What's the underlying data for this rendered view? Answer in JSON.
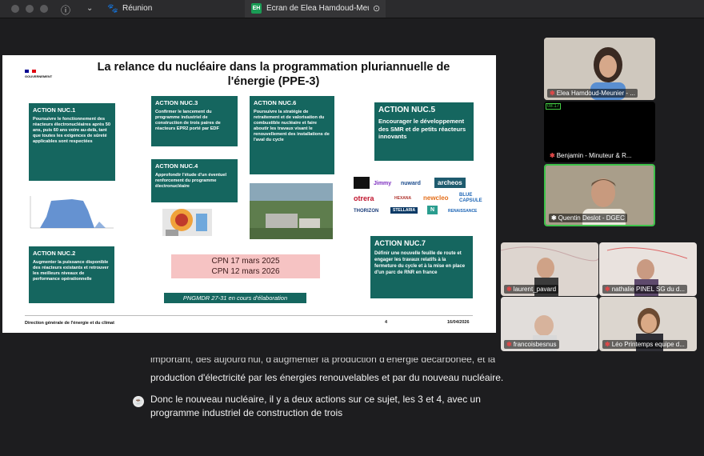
{
  "titlebar": {
    "meeting_title": "Réunion",
    "share_badge": "EH",
    "share_title": "Écran de Elea Hamdoud-Meu"
  },
  "slide": {
    "title_line1": "La relance du nucléaire dans la programmation pluriannuelle de",
    "title_line2": "l'énergie (PPE-3)",
    "gov_label": "GOUVERNEMENT",
    "actions": [
      {
        "title": "ACTION NUC.1",
        "body": "Poursuivre le fonctionnement des réacteurs électronucléaires après 50 ans, puis 60 ans voire au-delà, tant que toutes les exigences de sûreté applicables sont respectées"
      },
      {
        "title": "ACTION NUC.2",
        "body": "Augmenter la puissance disponible des réacteurs existants et retrouver les meilleurs niveaux de performance opérationnelle"
      },
      {
        "title": "ACTION NUC.3",
        "body": "Confirmer le lancement du programme industriel de construction de trois paires de réacteurs EPR2 porté par EDF"
      },
      {
        "title": "ACTION NUC.4",
        "body": "Approfondir l'étude d'un éventuel renforcement du programme électronucléaire"
      },
      {
        "title": "ACTION NUC.6",
        "body": "Poursuivre la stratégie de retraitement et de valorisation du combustible nucléaire et faire aboutir les travaux visant le renouvellement des installations de l'aval du cycle"
      },
      {
        "title": "ACTION NUC.5",
        "body": "Encourager le développement des SMR et de petits réacteurs innovants"
      },
      {
        "title": "ACTION NUC.7",
        "body": "Définir une nouvelle feuille de route et engager les travaux relatifs à la fermeture du cycle et à la mise en place d'un parc de RNR en france"
      }
    ],
    "cpn_line1": "CPN 17 mars 2025",
    "cpn_line2": "CPN 12 mars 2026",
    "pngmdr": "PNGMDR 27-31 en cours d'élaboration",
    "logos": [
      "Jimmy",
      "nuward",
      "archeos",
      "otrera",
      "HEXANA",
      "newcleo",
      "BLUE CAPSULE",
      "THORIZON",
      "STELLARIA",
      "N",
      "RENAISSANCE"
    ],
    "footer_left": "Direction générale de l'énergie et du climat",
    "footer_page": "4",
    "footer_date": "16/04/2026"
  },
  "participants": [
    {
      "name": "Elea Hamdoud-Meunier - ..."
    },
    {
      "name": "Benjamin - Minuteur & R..."
    },
    {
      "name": "Quentin Deslot - DGEC"
    },
    {
      "name": "laurent_pavard"
    },
    {
      "name": "nathalie PINEL SG du d..."
    },
    {
      "name": "francoisbesnus"
    },
    {
      "name": "Léo Printemps equipe d..."
    }
  ],
  "captions": {
    "line0": "important, dès aujourd'hui, d'augmenter la production d'énergie décarbonée, et la",
    "line1": "production d'électricité par les énergies renouvelables et par du nouveau nucléaire.",
    "line2": "Donc le nouveau nucléaire, il y a deux actions sur ce sujet, les 3 et 4, avec un",
    "line3": "programme industriel de construction de trois"
  },
  "colors": {
    "slide_box": "#15665f",
    "cpn_box": "#f6c3c3",
    "tile_active": "#3ec24a"
  }
}
